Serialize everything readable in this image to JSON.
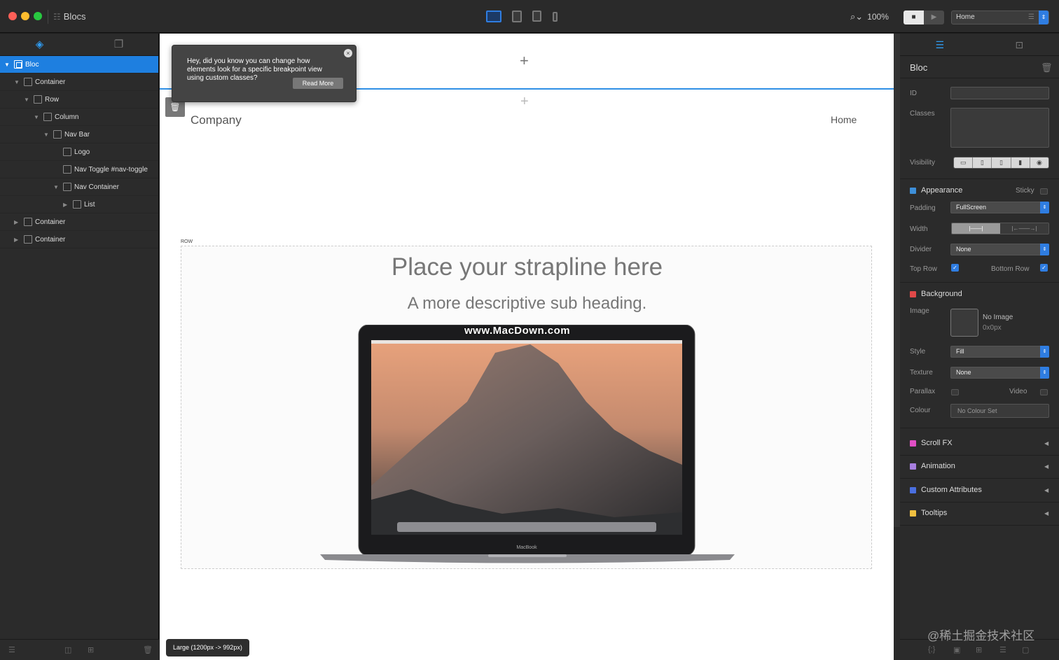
{
  "titlebar": {
    "app_title": "Blocs",
    "zoom": "100%",
    "page": "Home",
    "page_arrow": "⌃",
    "preview_stop": "■",
    "preview_play": "▶"
  },
  "left_panel": {
    "tabs": [
      {
        "icon": "layers-icon"
      },
      {
        "icon": "pages-icon"
      }
    ],
    "tree": [
      {
        "label": "Bloc",
        "depth": 0,
        "expanded": true,
        "selected": true
      },
      {
        "label": "Container",
        "depth": 1,
        "expanded": true
      },
      {
        "label": "Row",
        "depth": 2,
        "expanded": true
      },
      {
        "label": "Column",
        "depth": 3,
        "expanded": true
      },
      {
        "label": "Nav Bar",
        "depth": 4,
        "expanded": true
      },
      {
        "label": "Logo",
        "depth": 5
      },
      {
        "label": "Nav Toggle #nav-toggle",
        "depth": 5
      },
      {
        "label": "Nav Container",
        "depth": 5,
        "expanded": true
      },
      {
        "label": "List",
        "depth": 6,
        "expanded": false
      },
      {
        "label": "Container",
        "depth": 1,
        "expanded": false
      },
      {
        "label": "Container",
        "depth": 1,
        "expanded": false
      }
    ]
  },
  "tooltip": {
    "text": "Hey, did you know you can change how elements look for a specific breakpoint view using custom classes?",
    "button": "Read More",
    "close": "×"
  },
  "canvas": {
    "company": "Company",
    "nav_home": "Home",
    "row_label": "ROW",
    "strapline": "Place your strapline here",
    "subheading": "A more descriptive sub heading.",
    "watermark": "www.MacDown.com",
    "laptop_label": "MacBook",
    "breakpoint": "Large (1200px -> 992px)",
    "plus": "+"
  },
  "inspector": {
    "title": "Bloc",
    "id_label": "ID",
    "classes_label": "Classes",
    "visibility_label": "Visibility",
    "appearance": {
      "label": "Appearance",
      "color": "#3d8fd9",
      "sticky_label": "Sticky",
      "padding_label": "Padding",
      "padding_value": "FullScreen",
      "width_label": "Width",
      "width_opt1": "|——|",
      "width_opt2": "|←——→|",
      "divider_label": "Divider",
      "divider_value": "None",
      "top_row_label": "Top Row",
      "bottom_row_label": "Bottom Row",
      "check": "✓"
    },
    "background": {
      "label": "Background",
      "color": "#e04848",
      "image_label": "Image",
      "no_image": "No Image",
      "size": "0x0px",
      "style_label": "Style",
      "style_value": "Fill",
      "texture_label": "Texture",
      "texture_value": "None",
      "parallax_label": "Parallax",
      "video_label": "Video",
      "colour_label": "Colour",
      "colour_value": "No Colour Set"
    },
    "sections": [
      {
        "label": "Scroll FX",
        "color": "#e04fc4"
      },
      {
        "label": "Animation",
        "color": "#a87fe0"
      },
      {
        "label": "Custom Attributes",
        "color": "#4a6fe0"
      },
      {
        "label": "Tooltips",
        "color": "#f0c040"
      }
    ]
  },
  "overlay_text": "@稀土掘金技术社区"
}
